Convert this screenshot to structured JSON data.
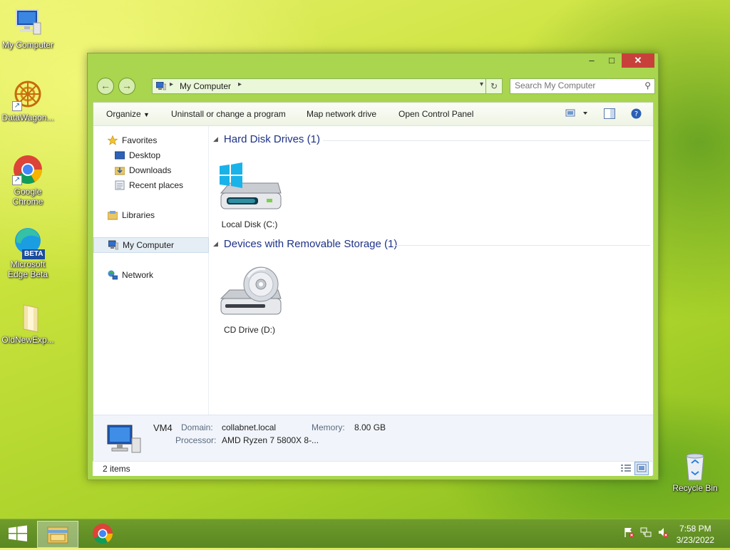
{
  "desktop": {
    "icons": [
      {
        "label": "My Computer"
      },
      {
        "label": "DataWagon..."
      },
      {
        "label": "Google Chrome"
      },
      {
        "label": "Microsoft Edge Beta",
        "badge": "BETA"
      },
      {
        "label": "OldNewExp..."
      },
      {
        "label": "Recycle Bin"
      }
    ]
  },
  "window": {
    "title_buttons": {
      "minimize": "–",
      "maximize": "□",
      "close": "✕"
    },
    "address": {
      "path": "My Computer"
    },
    "search": {
      "placeholder": "Search My Computer"
    },
    "toolbar": {
      "organize": "Organize",
      "uninstall": "Uninstall or change a program",
      "map_drive": "Map network drive",
      "control_panel": "Open Control Panel"
    },
    "nav": {
      "favorites": "Favorites",
      "desktop": "Desktop",
      "downloads": "Downloads",
      "recent": "Recent places",
      "libraries": "Libraries",
      "my_computer": "My Computer",
      "network": "Network"
    },
    "groups": {
      "hdd": "Hard Disk Drives (1)",
      "removable": "Devices with Removable Storage (1)"
    },
    "drives": {
      "c": "Local Disk (C:)",
      "d": "CD Drive (D:)"
    },
    "details": {
      "name": "VM4",
      "domain_label": "Domain:",
      "domain": "collabnet.local",
      "memory_label": "Memory:",
      "memory": "8.00 GB",
      "processor_label": "Processor:",
      "processor": "AMD Ryzen 7 5800X 8-..."
    },
    "status": {
      "items": "2 items"
    }
  },
  "taskbar": {
    "clock_time": "7:58 PM",
    "clock_date": "3/23/2022"
  },
  "colors": {
    "accent": "#1e3287",
    "window_frame": "#a9d54f",
    "close": "#c7413a"
  }
}
